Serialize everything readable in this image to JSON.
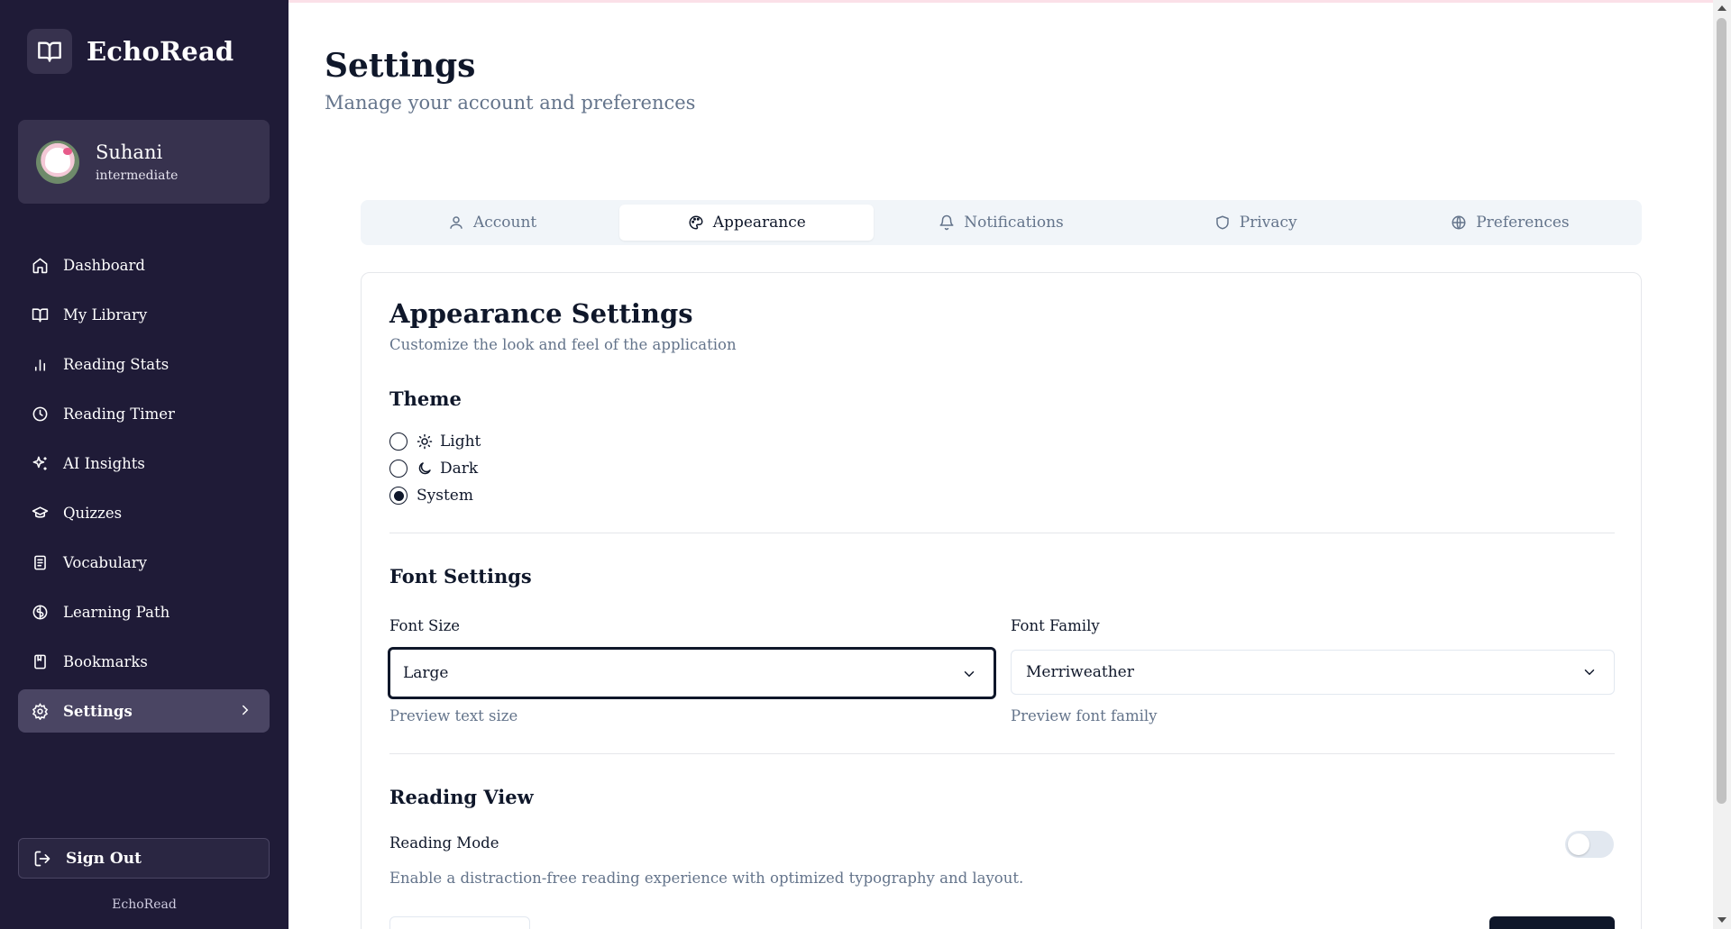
{
  "app": {
    "name": "EchoRead"
  },
  "user": {
    "name": "Suhani",
    "level": "intermediate"
  },
  "sidebar": {
    "items": [
      {
        "label": "Dashboard",
        "icon": "home-icon"
      },
      {
        "label": "My Library",
        "icon": "book-open-icon"
      },
      {
        "label": "Reading Stats",
        "icon": "bar-chart-icon"
      },
      {
        "label": "Reading Timer",
        "icon": "clock-icon"
      },
      {
        "label": "AI Insights",
        "icon": "sparkles-icon"
      },
      {
        "label": "Quizzes",
        "icon": "graduation-cap-icon"
      },
      {
        "label": "Vocabulary",
        "icon": "notebook-icon"
      },
      {
        "label": "Learning Path",
        "icon": "brain-icon"
      },
      {
        "label": "Bookmarks",
        "icon": "bookmark-icon"
      },
      {
        "label": "Settings",
        "icon": "gear-icon",
        "active": true
      }
    ],
    "sign_out": "Sign Out",
    "footer": "EchoRead"
  },
  "header": {
    "title": "Settings",
    "subtitle": "Manage your account and preferences"
  },
  "tabs": [
    {
      "label": "Account",
      "icon": "user-icon"
    },
    {
      "label": "Appearance",
      "icon": "palette-icon",
      "active": true
    },
    {
      "label": "Notifications",
      "icon": "bell-icon"
    },
    {
      "label": "Privacy",
      "icon": "shield-icon"
    },
    {
      "label": "Preferences",
      "icon": "globe-icon"
    }
  ],
  "appearance": {
    "title": "Appearance Settings",
    "description": "Customize the look and feel of the application",
    "theme": {
      "heading": "Theme",
      "options": [
        {
          "label": "Light",
          "icon": "sun-icon",
          "selected": false
        },
        {
          "label": "Dark",
          "icon": "moon-icon",
          "selected": false
        },
        {
          "label": "System",
          "selected": true
        }
      ]
    },
    "font": {
      "heading": "Font Settings",
      "size_label": "Font Size",
      "size_value": "Large",
      "size_preview": "Preview text size",
      "family_label": "Font Family",
      "family_value": "Merriweather",
      "family_preview": "Preview font family"
    },
    "reading_view": {
      "heading": "Reading View",
      "mode_label": "Reading Mode",
      "mode_description": "Enable a distraction-free reading experience with optimized typography and layout.",
      "mode_enabled": false
    }
  },
  "colors": {
    "sidebar_bg": "#1f1b37",
    "sidebar_card": "#37324e",
    "accent_dark": "#0f172a",
    "muted_text": "#64748b"
  }
}
